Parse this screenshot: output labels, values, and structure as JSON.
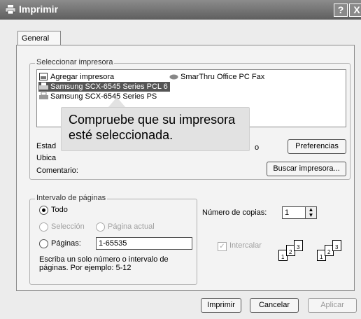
{
  "window": {
    "title": "Imprimir",
    "help_label": "?",
    "close_label": "X"
  },
  "tabs": [
    {
      "label": "General"
    }
  ],
  "printer_group": {
    "label": "Seleccionar impresora",
    "items": [
      {
        "label": "Agregar impresora",
        "icon": "add-printer-icon"
      },
      {
        "label": "SmarThru Office PC Fax",
        "icon": "fax-icon"
      },
      {
        "label": "Samsung SCX-6545 Series PCL 6",
        "icon": "printer-icon",
        "selected": true
      },
      {
        "label": "Samsung SCX-6545 Series PS",
        "icon": "printer-icon"
      }
    ],
    "status_label": "Estad",
    "location_label": "Ubica",
    "obscured_suffix": "o",
    "comment_label": "Comentario:",
    "preferences_button": "Preferencias",
    "find_printer_button": "Buscar impresora..."
  },
  "callout": {
    "line1": "Compruebe que su impresora",
    "line2": "esté seleccionada."
  },
  "range_group": {
    "label": "Intervalo de páginas",
    "all": "Todo",
    "selection": "Selección",
    "current_page": "Página actual",
    "pages": "Páginas:",
    "pages_value": "1-65535",
    "hint_line1": "Escriba un solo número o intervalo de",
    "hint_line2": "páginas. Por ejemplo: 5-12"
  },
  "copies": {
    "label": "Número de copias:",
    "value": "1",
    "collate": "Intercalar"
  },
  "footer": {
    "print": "Imprimir",
    "cancel": "Cancelar",
    "apply": "Aplicar"
  }
}
